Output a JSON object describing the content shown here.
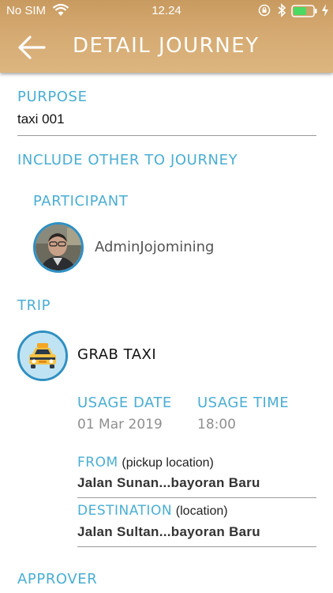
{
  "status_bar": {
    "carrier": "No SIM",
    "time": "12.24",
    "wifi_icon": "wifi-icon",
    "orientation_lock_icon": "orientation-lock-icon",
    "bluetooth_icon": "bluetooth-icon",
    "battery_icon": "battery-icon",
    "charging_icon": "charging-bolt-icon"
  },
  "header": {
    "title": "DETAIL JOURNEY",
    "back_icon": "arrow-left-icon",
    "color": "#d4a970"
  },
  "purpose": {
    "label": "PURPOSE",
    "value": "taxi 001"
  },
  "include_others": {
    "label": "INCLUDE OTHER TO JOURNEY"
  },
  "participant": {
    "label": "PARTICIPANT",
    "name": "AdminJojomining"
  },
  "trip": {
    "label": "TRIP",
    "name": "GRAB TAXI",
    "icon": "taxi-icon",
    "usage_date_label": "USAGE DATE",
    "usage_date": "01 Mar 2019",
    "usage_time_label": "USAGE TIME",
    "usage_time": "18:00",
    "from_label": "FROM",
    "from_hint": "(pickup location)",
    "from_value": "Jalan Sunan...bayoran Baru",
    "destination_label": "DESTINATION",
    "destination_hint": "(location)",
    "destination_value": "Jalan Sultan...bayoran Baru"
  },
  "approver": {
    "label": "APPROVER"
  },
  "colors": {
    "accent": "#4aaed3",
    "header_gold": "#d4a970",
    "ring_blue": "#2f8fc2"
  }
}
